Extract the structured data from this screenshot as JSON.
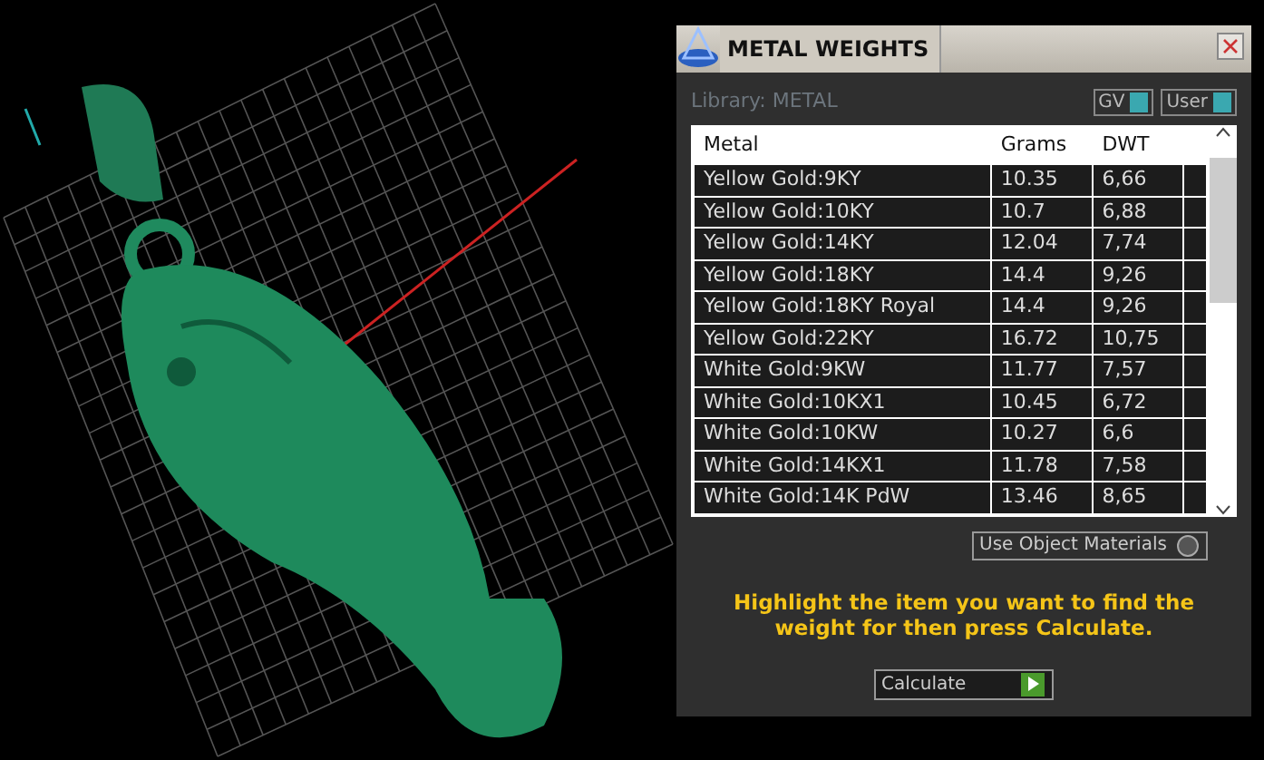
{
  "panel": {
    "title": "METAL WEIGHTS",
    "library_label": "Library: METAL",
    "toggles": [
      {
        "label": "GV",
        "on": true
      },
      {
        "label": "User",
        "on": true
      }
    ],
    "table": {
      "columns": [
        "Metal",
        "Grams",
        "DWT"
      ],
      "rows": [
        [
          "Yellow Gold:9KY",
          "10.35",
          "6,66"
        ],
        [
          "Yellow Gold:10KY",
          "10.7",
          "6,88"
        ],
        [
          "Yellow Gold:14KY",
          "12.04",
          "7,74"
        ],
        [
          "Yellow Gold:18KY",
          "14.4",
          "9,26"
        ],
        [
          "Yellow Gold:18KY Royal",
          "14.4",
          "9,26"
        ],
        [
          "Yellow Gold:22KY",
          "16.72",
          "10,75"
        ],
        [
          "White Gold:9KW",
          "11.77",
          "7,57"
        ],
        [
          "White Gold:10KX1",
          "10.45",
          "6,72"
        ],
        [
          "White Gold:10KW",
          "10.27",
          "6,6"
        ],
        [
          "White Gold:14KX1",
          "11.78",
          "7,58"
        ],
        [
          "White Gold:14K PdW",
          "13.46",
          "8,65"
        ]
      ]
    },
    "use_object_materials": {
      "label": "Use Object Materials",
      "on": false
    },
    "instruction": "Highlight the item you want to find the weight for then press Calculate.",
    "calculate_button": "Calculate"
  }
}
